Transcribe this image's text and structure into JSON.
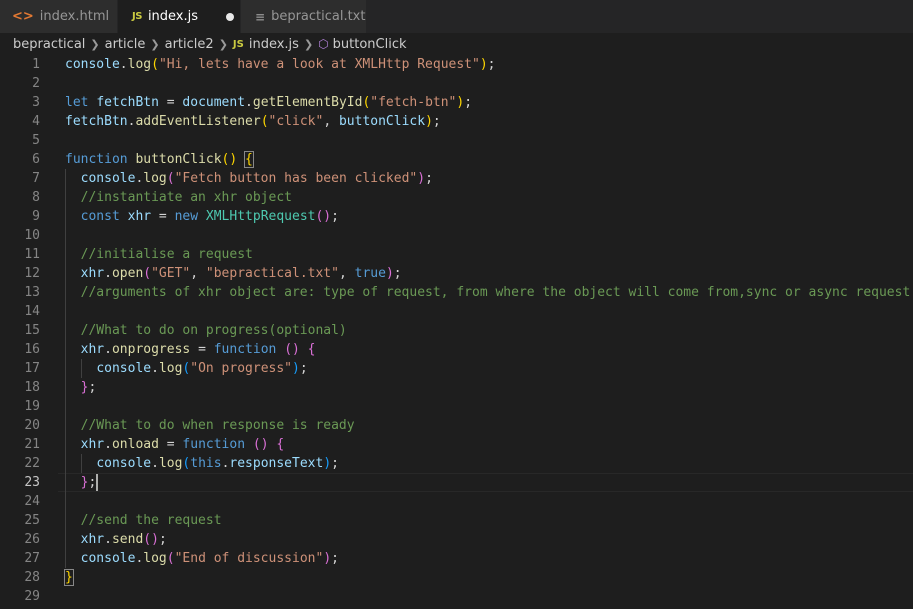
{
  "tabs": [
    {
      "label": "index.html",
      "icon": "html-icon",
      "glyph": "<>"
    },
    {
      "label": "index.js",
      "icon": "js-icon",
      "glyph": "JS",
      "modified": true
    },
    {
      "label": "bepractical.txt",
      "icon": "txt-icon",
      "glyph": "≡"
    }
  ],
  "breadcrumb": [
    "bepractical",
    "article",
    "article2",
    "index.js",
    "buttonClick"
  ],
  "editor": {
    "current_line": 23,
    "lines": [
      {
        "n": "1",
        "t": [
          [
            "var",
            "console"
          ],
          [
            "op",
            "."
          ],
          [
            "fn",
            "log"
          ],
          [
            "p1",
            "("
          ],
          [
            "str",
            "\"Hi, lets have a look at XMLHttp Request\""
          ],
          [
            "p1",
            ")"
          ],
          [
            "op",
            ";"
          ]
        ]
      },
      {
        "n": "2",
        "t": []
      },
      {
        "n": "3",
        "t": [
          [
            "kw",
            "let "
          ],
          [
            "var",
            "fetchBtn"
          ],
          [
            "op",
            " = "
          ],
          [
            "var",
            "document"
          ],
          [
            "op",
            "."
          ],
          [
            "fn",
            "getElementById"
          ],
          [
            "p1",
            "("
          ],
          [
            "str",
            "\"fetch-btn\""
          ],
          [
            "p1",
            ")"
          ],
          [
            "op",
            ";"
          ]
        ]
      },
      {
        "n": "4",
        "t": [
          [
            "var",
            "fetchBtn"
          ],
          [
            "op",
            "."
          ],
          [
            "fn",
            "addEventListener"
          ],
          [
            "p1",
            "("
          ],
          [
            "str",
            "\"click\""
          ],
          [
            "op",
            ", "
          ],
          [
            "var",
            "buttonClick"
          ],
          [
            "p1",
            ")"
          ],
          [
            "op",
            ";"
          ]
        ]
      },
      {
        "n": "5",
        "t": []
      },
      {
        "n": "6",
        "t": [
          [
            "kw",
            "function "
          ],
          [
            "fn",
            "buttonClick"
          ],
          [
            "p1",
            "()"
          ],
          [
            "op",
            " "
          ],
          [
            "p1b",
            "{"
          ]
        ]
      },
      {
        "n": "7",
        "t": [
          [
            "op",
            "  "
          ],
          [
            "var",
            "console"
          ],
          [
            "op",
            "."
          ],
          [
            "fn",
            "log"
          ],
          [
            "p2",
            "("
          ],
          [
            "str",
            "\"Fetch button has been clicked\""
          ],
          [
            "p2",
            ")"
          ],
          [
            "op",
            ";"
          ]
        ]
      },
      {
        "n": "8",
        "t": [
          [
            "op",
            "  "
          ],
          [
            "com",
            "//instantiate an xhr object"
          ]
        ]
      },
      {
        "n": "9",
        "t": [
          [
            "op",
            "  "
          ],
          [
            "kw",
            "const "
          ],
          [
            "var",
            "xhr"
          ],
          [
            "op",
            " = "
          ],
          [
            "kw",
            "new "
          ],
          [
            "cls",
            "XMLHttpRequest"
          ],
          [
            "p2",
            "()"
          ],
          [
            "op",
            ";"
          ]
        ]
      },
      {
        "n": "10",
        "t": []
      },
      {
        "n": "11",
        "t": [
          [
            "op",
            "  "
          ],
          [
            "com",
            "//initialise a request"
          ]
        ]
      },
      {
        "n": "12",
        "t": [
          [
            "op",
            "  "
          ],
          [
            "var",
            "xhr"
          ],
          [
            "op",
            "."
          ],
          [
            "fn",
            "open"
          ],
          [
            "p2",
            "("
          ],
          [
            "str",
            "\"GET\""
          ],
          [
            "op",
            ", "
          ],
          [
            "str",
            "\"bepractical.txt\""
          ],
          [
            "op",
            ", "
          ],
          [
            "kw",
            "true"
          ],
          [
            "p2",
            ")"
          ],
          [
            "op",
            ";"
          ]
        ]
      },
      {
        "n": "13",
        "t": [
          [
            "op",
            "  "
          ],
          [
            "com",
            "//arguments of xhr object are: type of request, from where the object will come from,sync or async request"
          ]
        ]
      },
      {
        "n": "14",
        "t": []
      },
      {
        "n": "15",
        "t": [
          [
            "op",
            "  "
          ],
          [
            "com",
            "//What to do on progress(optional)"
          ]
        ]
      },
      {
        "n": "16",
        "t": [
          [
            "op",
            "  "
          ],
          [
            "var",
            "xhr"
          ],
          [
            "op",
            "."
          ],
          [
            "fn",
            "onprogress"
          ],
          [
            "op",
            " = "
          ],
          [
            "kw",
            "function "
          ],
          [
            "p2",
            "()"
          ],
          [
            "op",
            " "
          ],
          [
            "p2",
            "{"
          ]
        ]
      },
      {
        "n": "17",
        "t": [
          [
            "op",
            "    "
          ],
          [
            "var",
            "console"
          ],
          [
            "op",
            "."
          ],
          [
            "fn",
            "log"
          ],
          [
            "p3",
            "("
          ],
          [
            "str",
            "\"On progress\""
          ],
          [
            "p3",
            ")"
          ],
          [
            "op",
            ";"
          ]
        ]
      },
      {
        "n": "18",
        "t": [
          [
            "op",
            "  "
          ],
          [
            "p2",
            "}"
          ],
          [
            "op",
            ";"
          ]
        ]
      },
      {
        "n": "19",
        "t": []
      },
      {
        "n": "20",
        "t": [
          [
            "op",
            "  "
          ],
          [
            "com",
            "//What to do when response is ready"
          ]
        ]
      },
      {
        "n": "21",
        "t": [
          [
            "op",
            "  "
          ],
          [
            "var",
            "xhr"
          ],
          [
            "op",
            "."
          ],
          [
            "fn",
            "onload"
          ],
          [
            "op",
            " = "
          ],
          [
            "kw",
            "function "
          ],
          [
            "p2",
            "()"
          ],
          [
            "op",
            " "
          ],
          [
            "p2",
            "{"
          ]
        ]
      },
      {
        "n": "22",
        "t": [
          [
            "op",
            "    "
          ],
          [
            "var",
            "console"
          ],
          [
            "op",
            "."
          ],
          [
            "fn",
            "log"
          ],
          [
            "p3",
            "("
          ],
          [
            "kw",
            "this"
          ],
          [
            "op",
            "."
          ],
          [
            "var",
            "responseText"
          ],
          [
            "p3",
            ")"
          ],
          [
            "op",
            ";"
          ]
        ]
      },
      {
        "n": "23",
        "t": [
          [
            "op",
            "  "
          ],
          [
            "p2",
            "}"
          ],
          [
            "op",
            ";"
          ],
          [
            "cursor",
            ""
          ]
        ]
      },
      {
        "n": "24",
        "t": []
      },
      {
        "n": "25",
        "t": [
          [
            "op",
            "  "
          ],
          [
            "com",
            "//send the request"
          ]
        ]
      },
      {
        "n": "26",
        "t": [
          [
            "op",
            "  "
          ],
          [
            "var",
            "xhr"
          ],
          [
            "op",
            "."
          ],
          [
            "fn",
            "send"
          ],
          [
            "p2",
            "()"
          ],
          [
            "op",
            ";"
          ]
        ]
      },
      {
        "n": "27",
        "t": [
          [
            "op",
            "  "
          ],
          [
            "var",
            "console"
          ],
          [
            "op",
            "."
          ],
          [
            "fn",
            "log"
          ],
          [
            "p2",
            "("
          ],
          [
            "str",
            "\"End of discussion\""
          ],
          [
            "p2",
            ")"
          ],
          [
            "op",
            ";"
          ]
        ]
      },
      {
        "n": "28",
        "t": [
          [
            "p1b",
            "}"
          ]
        ]
      },
      {
        "n": "29",
        "t": []
      }
    ]
  }
}
